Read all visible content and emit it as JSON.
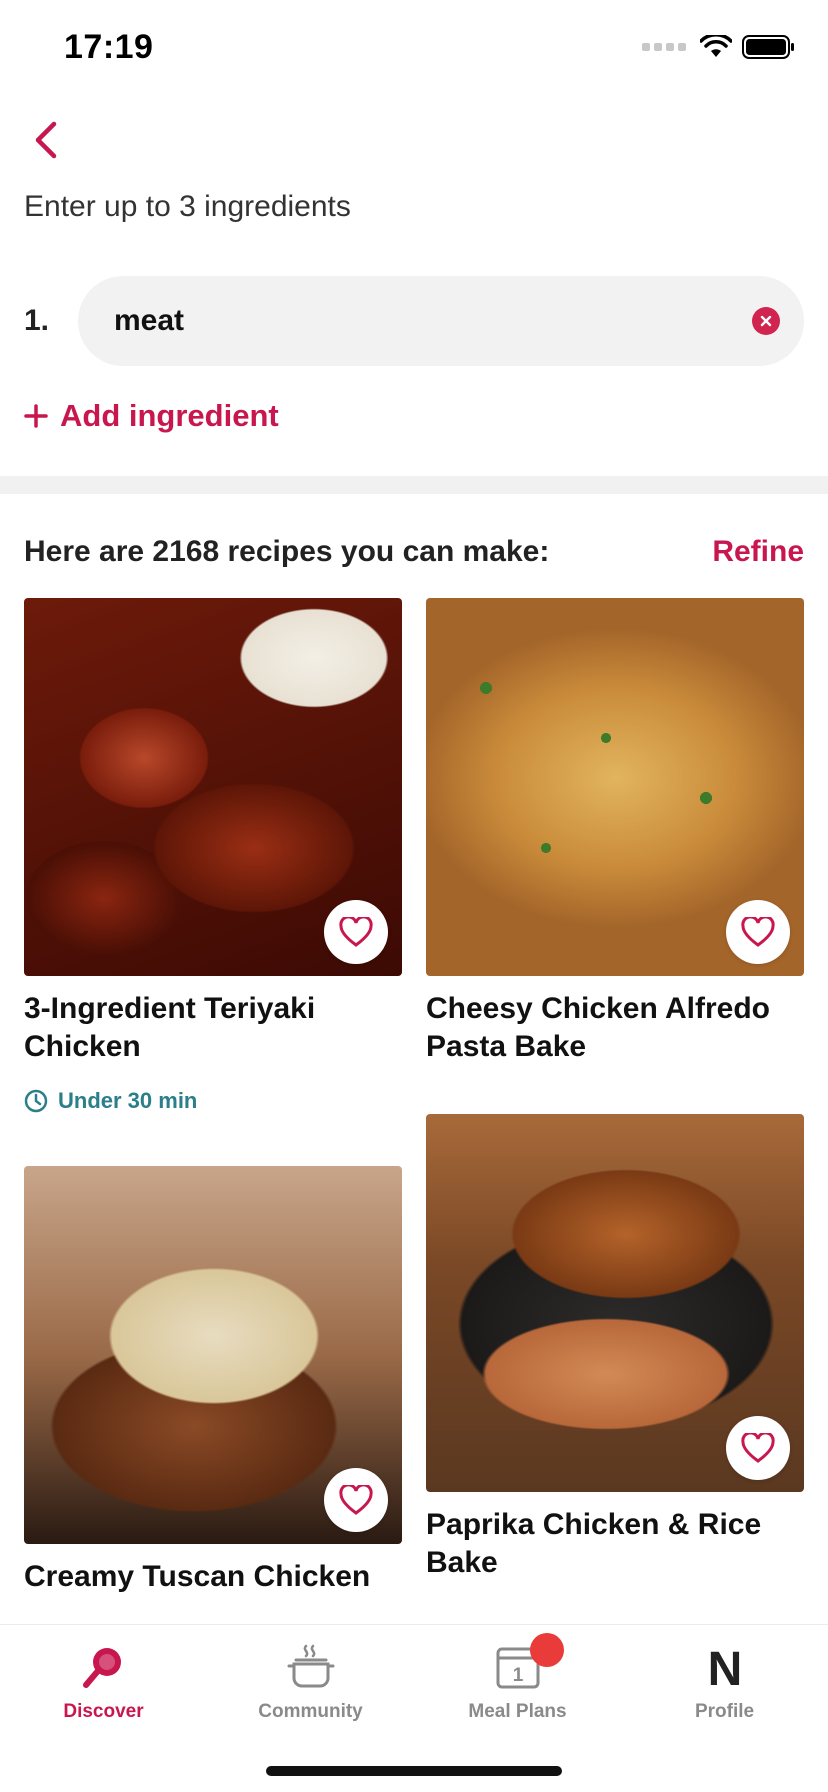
{
  "status_bar": {
    "time": "17:19"
  },
  "header": {
    "back_icon": "chevron-left-icon",
    "prompt": "Enter up to 3 ingredients"
  },
  "ingredients": [
    {
      "number": "1.",
      "value": "meat",
      "placeholder": ""
    }
  ],
  "add_ingredient_label": "Add ingredient",
  "results": {
    "text": "Here are 2168 recipes you can make:",
    "refine_label": "Refine"
  },
  "recipes": [
    {
      "title": "3-Ingredient Teriyaki Chicken",
      "meta": "Under 30 min"
    },
    {
      "title": "Cheesy Chicken Alfredo Pasta Bake"
    },
    {
      "title": "Creamy Tuscan Chicken"
    },
    {
      "title": "Paprika Chicken & Rice Bake"
    }
  ],
  "tabs": [
    {
      "label": "Discover",
      "icon": "discover-icon",
      "active": true
    },
    {
      "label": "Community",
      "icon": "pot-icon"
    },
    {
      "label": "Meal Plans",
      "icon": "calendar-icon",
      "calendar_day": "1",
      "has_badge": true
    },
    {
      "label": "Profile",
      "icon": "profile-logo-icon",
      "glyph": "N"
    }
  ],
  "colors": {
    "accent": "#c8174f",
    "meta": "#2b7f8a",
    "badge": "#ea3b3b"
  }
}
